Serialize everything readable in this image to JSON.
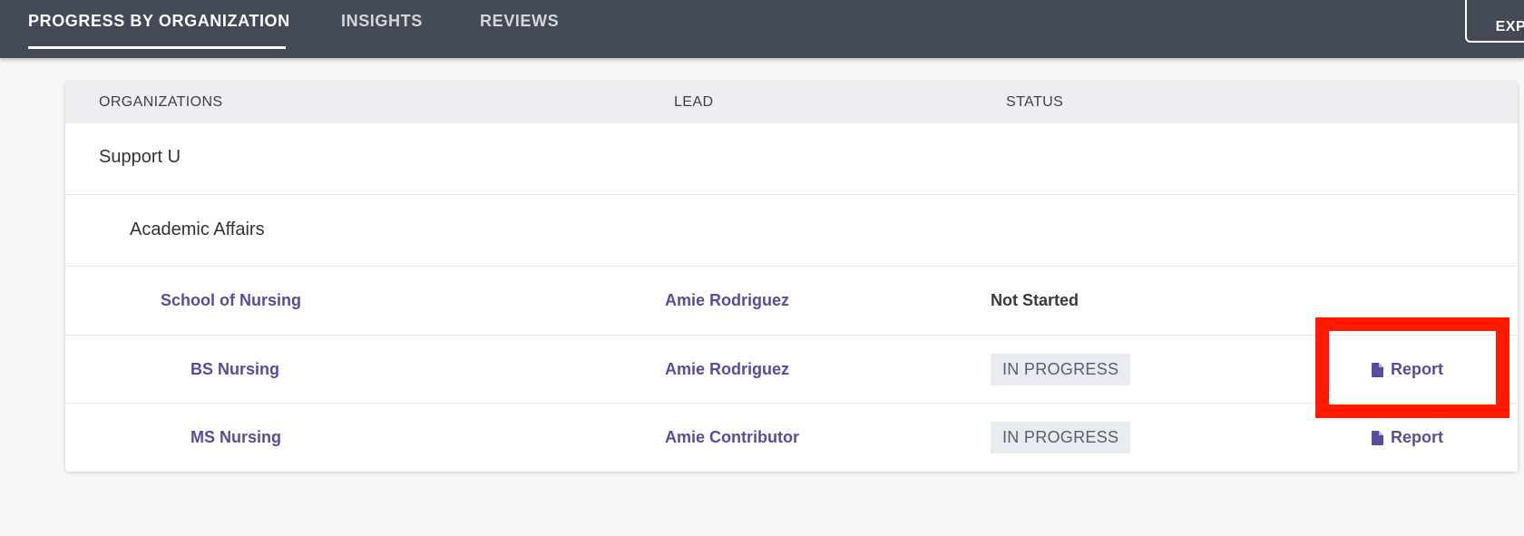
{
  "nav": {
    "tabs": [
      {
        "label": "PROGRESS BY ORGANIZATION",
        "active": true
      },
      {
        "label": "INSIGHTS",
        "active": false
      },
      {
        "label": "REVIEWS",
        "active": false
      }
    ],
    "export_label": "EXPORT"
  },
  "table": {
    "headers": {
      "organizations": "ORGANIZATIONS",
      "lead": "LEAD",
      "status": "STATUS"
    },
    "rows": [
      {
        "org": "Support U"
      },
      {
        "org": "Academic Affairs"
      },
      {
        "org": "School of Nursing",
        "lead": "Amie Rodriguez",
        "status": "Not Started"
      },
      {
        "org": "BS Nursing",
        "lead": "Amie Rodriguez",
        "status": "IN PROGRESS",
        "action": "Report"
      },
      {
        "org": "MS Nursing",
        "lead": "Amie Contributor",
        "status": "IN PROGRESS",
        "action": "Report"
      }
    ]
  },
  "icons": {
    "report": "document-icon"
  },
  "colors": {
    "topbar": "#444a55",
    "link": "#574d9b",
    "highlight": "#ff1a00",
    "badge_bg": "#e8ecf0"
  }
}
